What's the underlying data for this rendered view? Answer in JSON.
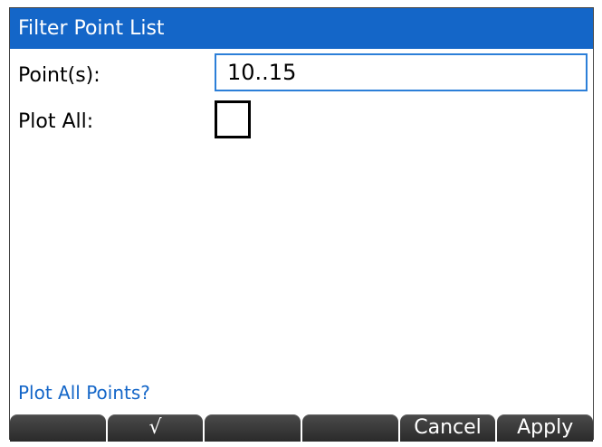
{
  "title": "Filter Point List",
  "fields": {
    "points_label": "Point(s):",
    "points_value": "10..15",
    "plot_all_label": "Plot All:",
    "plot_all_checked": false
  },
  "help_text": "Plot All Points?",
  "softkeys": [
    "",
    "√",
    "",
    "",
    "Cancel",
    "Apply"
  ],
  "colors": {
    "titlebar": "#1466c8",
    "help_text": "#1466c8",
    "input_border": "#2c7fd8",
    "softkey_bg": "#2f2f2f"
  }
}
